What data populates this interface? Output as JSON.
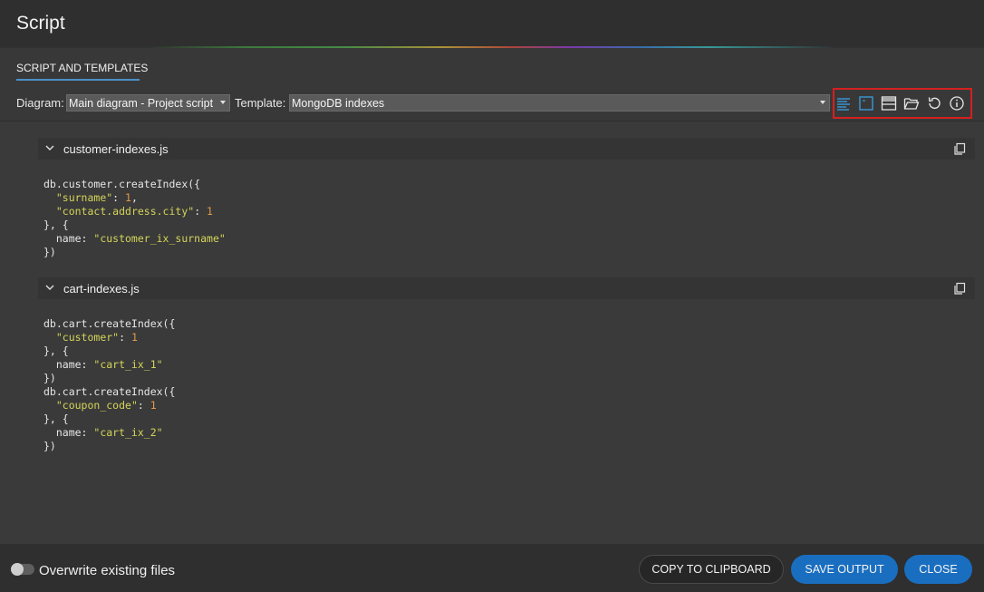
{
  "window": {
    "title": "Script"
  },
  "tabs": [
    {
      "label": "SCRIPT AND TEMPLATES",
      "active": true
    }
  ],
  "toolbar": {
    "diagram_label": "Diagram:",
    "diagram_value": "Main diagram - Project script",
    "template_label": "Template:",
    "template_value": "MongoDB indexes",
    "icons": [
      "text-lines-icon",
      "script-icon",
      "layout-icon",
      "folder-open-icon",
      "refresh-icon",
      "info-icon"
    ]
  },
  "sections": [
    {
      "name": "customer-indexes.js",
      "lines": [
        [
          {
            "t": "db.customer.createIndex({"
          }
        ],
        [
          {
            "t": "  "
          },
          {
            "t": "\"surname\"",
            "c": "s"
          },
          {
            "t": ": "
          },
          {
            "t": "1",
            "c": "n"
          },
          {
            "t": ","
          }
        ],
        [
          {
            "t": "  "
          },
          {
            "t": "\"contact.address.city\"",
            "c": "s"
          },
          {
            "t": ": "
          },
          {
            "t": "1",
            "c": "n"
          }
        ],
        [
          {
            "t": "}, {"
          }
        ],
        [
          {
            "t": "  name: "
          },
          {
            "t": "\"customer_ix_surname\"",
            "c": "s"
          }
        ],
        [
          {
            "t": "})"
          }
        ]
      ]
    },
    {
      "name": "cart-indexes.js",
      "lines": [
        [
          {
            "t": "db.cart.createIndex({"
          }
        ],
        [
          {
            "t": "  "
          },
          {
            "t": "\"customer\"",
            "c": "s"
          },
          {
            "t": ": "
          },
          {
            "t": "1",
            "c": "n"
          }
        ],
        [
          {
            "t": "}, {"
          }
        ],
        [
          {
            "t": "  name: "
          },
          {
            "t": "\"cart_ix_1\"",
            "c": "s"
          }
        ],
        [
          {
            "t": "})"
          }
        ],
        [
          {
            "t": "db.cart.createIndex({"
          }
        ],
        [
          {
            "t": "  "
          },
          {
            "t": "\"coupon_code\"",
            "c": "s"
          },
          {
            "t": ": "
          },
          {
            "t": "1",
            "c": "n"
          }
        ],
        [
          {
            "t": "}, {"
          }
        ],
        [
          {
            "t": "  name: "
          },
          {
            "t": "\"cart_ix_2\"",
            "c": "s"
          }
        ],
        [
          {
            "t": "})"
          }
        ]
      ]
    }
  ],
  "footer": {
    "overwrite_label": "Overwrite existing files",
    "overwrite_on": false,
    "copy_label": "COPY TO CLIPBOARD",
    "save_label": "SAVE OUTPUT",
    "close_label": "CLOSE"
  },
  "colors": {
    "accent": "#1a6ec0",
    "string": "#d4d45a",
    "number": "#e09a4a",
    "highlight_box": "#d42020"
  }
}
